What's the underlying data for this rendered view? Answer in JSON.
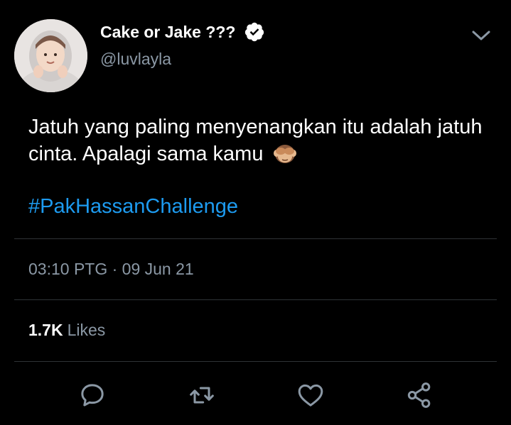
{
  "tweet": {
    "author_name": "Cake or Jake ???",
    "author_handle": "@luvlayla",
    "text": "Jatuh yang paling menyenangkan itu adalah jatuh cinta. Apalagi sama kamu",
    "emoji": "see-no-evil-monkey-icon",
    "hashtag": "#PakHassanChallenge",
    "timestamp": "03:10 PTG · 09 Jun 21",
    "likes_count": "1.7K",
    "likes_label": "Likes"
  },
  "actions": [
    {
      "icon": "reply-icon"
    },
    {
      "icon": "retweet-icon"
    },
    {
      "icon": "like-icon"
    },
    {
      "icon": "share-icon"
    }
  ],
  "colors": {
    "background": "#000000",
    "text": "#ffffff",
    "secondary": "#8b98a5",
    "link": "#1d9bf0",
    "divider": "#2f3336"
  }
}
